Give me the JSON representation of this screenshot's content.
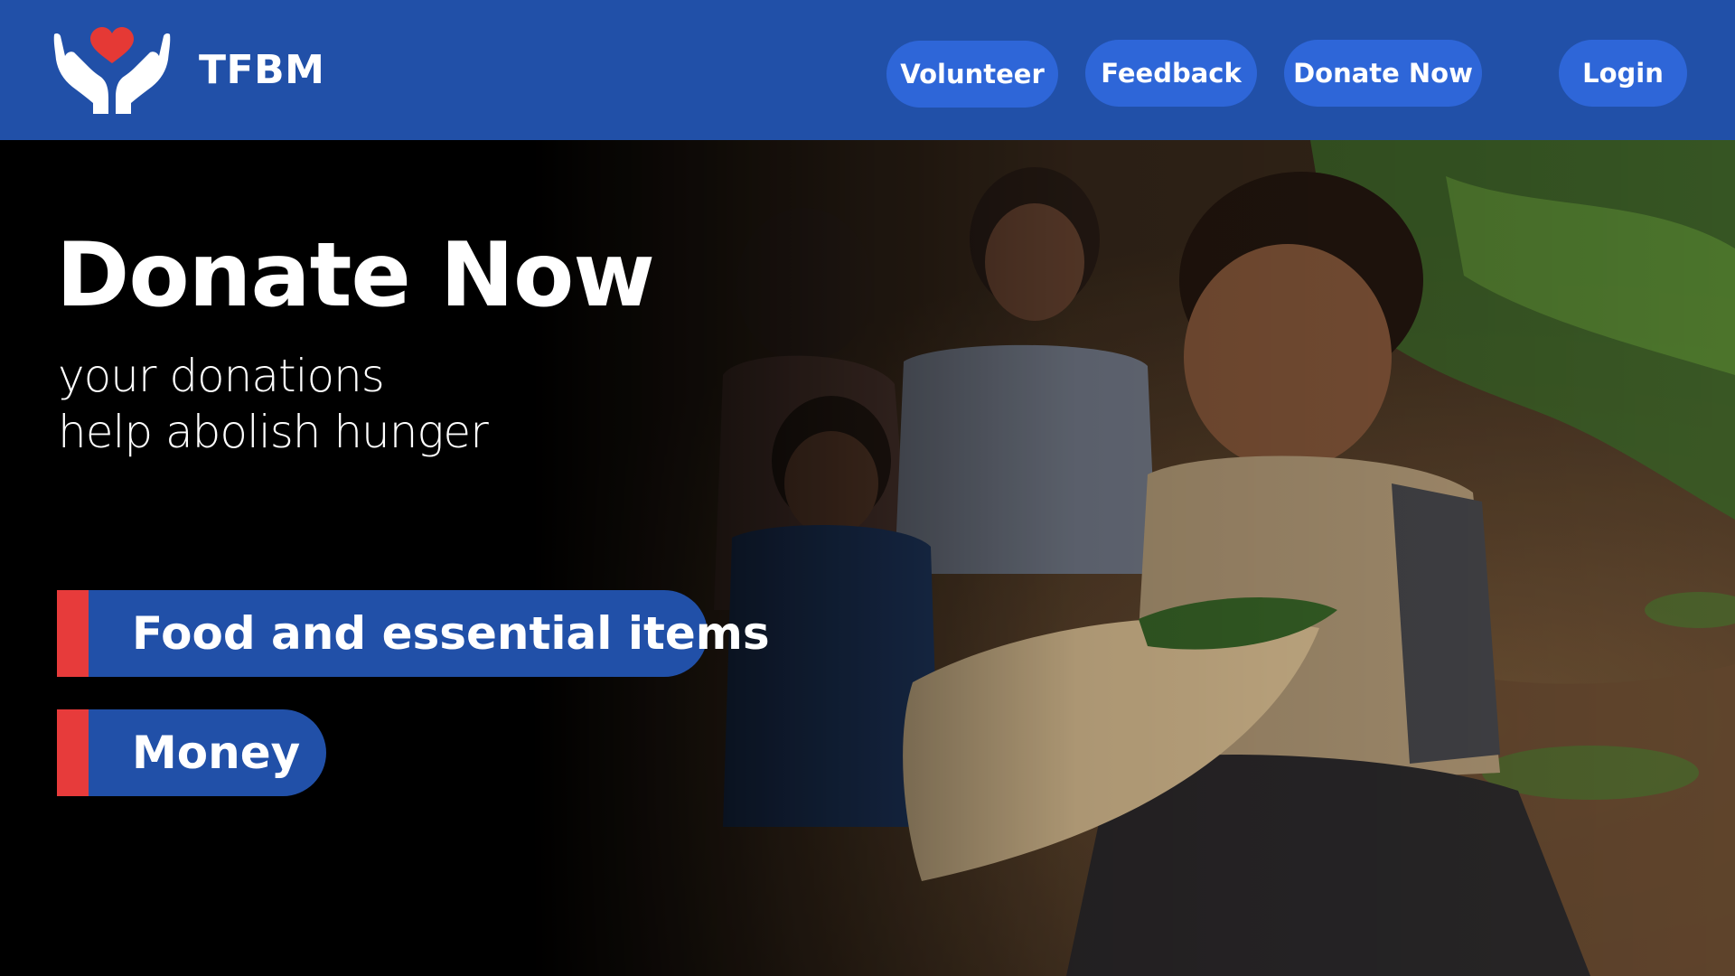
{
  "header": {
    "brand": "TFBM",
    "logo_icon": "hands-holding-heart-icon",
    "nav": {
      "volunteer": "Volunteer",
      "feedback": "Feedback",
      "donate": "Donate Now",
      "login": "Login"
    }
  },
  "hero": {
    "title": "Donate Now",
    "subtitle_line1": "your donations",
    "subtitle_line2": "help abolish hunger",
    "options": {
      "food": "Food and essential items",
      "money": "Money"
    }
  },
  "colors": {
    "nav_bg": "#2150a8",
    "nav_button": "#2e66d8",
    "accent_red": "#e73b3b",
    "heart": "#e53935",
    "text": "#ffffff"
  }
}
